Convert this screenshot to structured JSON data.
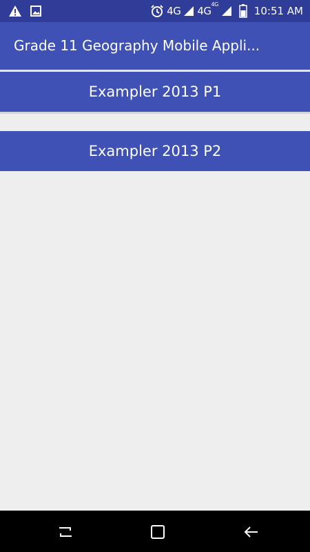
{
  "status_bar": {
    "network_1": "4G",
    "network_2": "4G",
    "network_2_super": "4G",
    "time": "10:51 AM",
    "icons": [
      "warning-icon",
      "image-icon",
      "alarm-icon",
      "signal-icon",
      "signal-icon",
      "battery-icon"
    ]
  },
  "app_bar": {
    "title": "Grade 11 Geography Mobile Appli..."
  },
  "buttons": [
    {
      "label": "Exampler 2013 P1"
    },
    {
      "label": "Exampler 2013 P2"
    }
  ],
  "colors": {
    "status_bar": "#2F3D99",
    "primary": "#3F51B5",
    "background": "#EEEEEE",
    "nav_bar": "#000000"
  },
  "nav_bar": {
    "icons": [
      "recent-apps-icon",
      "home-icon",
      "back-icon"
    ]
  }
}
